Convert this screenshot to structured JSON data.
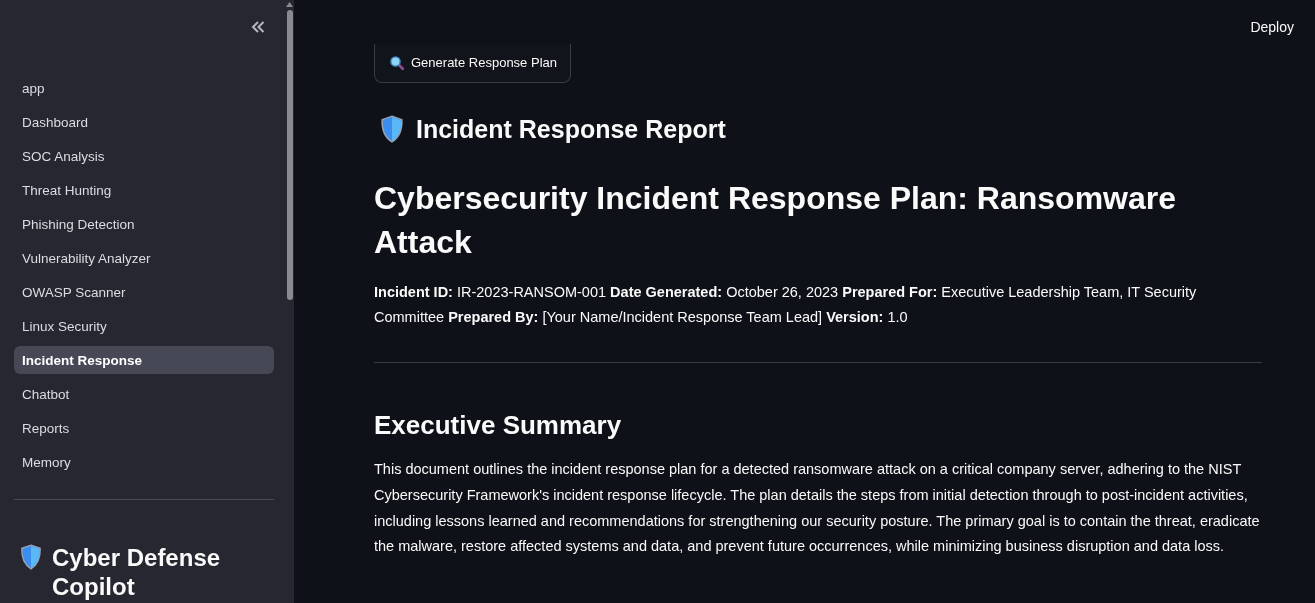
{
  "sidebar": {
    "nav_items": [
      {
        "label": "app",
        "selected": false
      },
      {
        "label": "Dashboard",
        "selected": false
      },
      {
        "label": "SOC Analysis",
        "selected": false
      },
      {
        "label": "Threat Hunting",
        "selected": false
      },
      {
        "label": "Phishing Detection",
        "selected": false
      },
      {
        "label": "Vulnerability Analyzer",
        "selected": false
      },
      {
        "label": "OWASP Scanner",
        "selected": false
      },
      {
        "label": "Linux Security",
        "selected": false
      },
      {
        "label": "Incident Response",
        "selected": true
      },
      {
        "label": "Chatbot",
        "selected": false
      },
      {
        "label": "Reports",
        "selected": false
      },
      {
        "label": "Memory",
        "selected": false
      }
    ],
    "title": "Cyber Defense Copilot"
  },
  "header": {
    "deploy_button": "Deploy"
  },
  "main": {
    "action_button": "Generate Response Plan",
    "report_heading": "Incident Response Report",
    "title": "Cybersecurity Incident Response Plan: Ransomware Attack",
    "meta": "**Incident ID:** IR-2023-RANSOM-001 **Date Generated:** October 26, 2023 **Prepared For:** Executive Leadership Team, IT Security Committee **Prepared By:** [Your Name/Incident Response Team Lead] **Version:** 1.0",
    "sections": [
      {
        "heading": "Executive Summary",
        "body": "This document outlines the incident response plan for a detected ransomware attack on a critical company server, adhering to the NIST Cybersecurity Framework's incident response lifecycle. The plan details the steps from initial detection through to post-incident activities, including lessons learned and recommendations for strengthening our security posture. The primary goal is to contain the threat, eradicate the malware, restore affected systems and data, and prevent future occurrences, while minimizing business disruption and data loss."
      }
    ]
  }
}
